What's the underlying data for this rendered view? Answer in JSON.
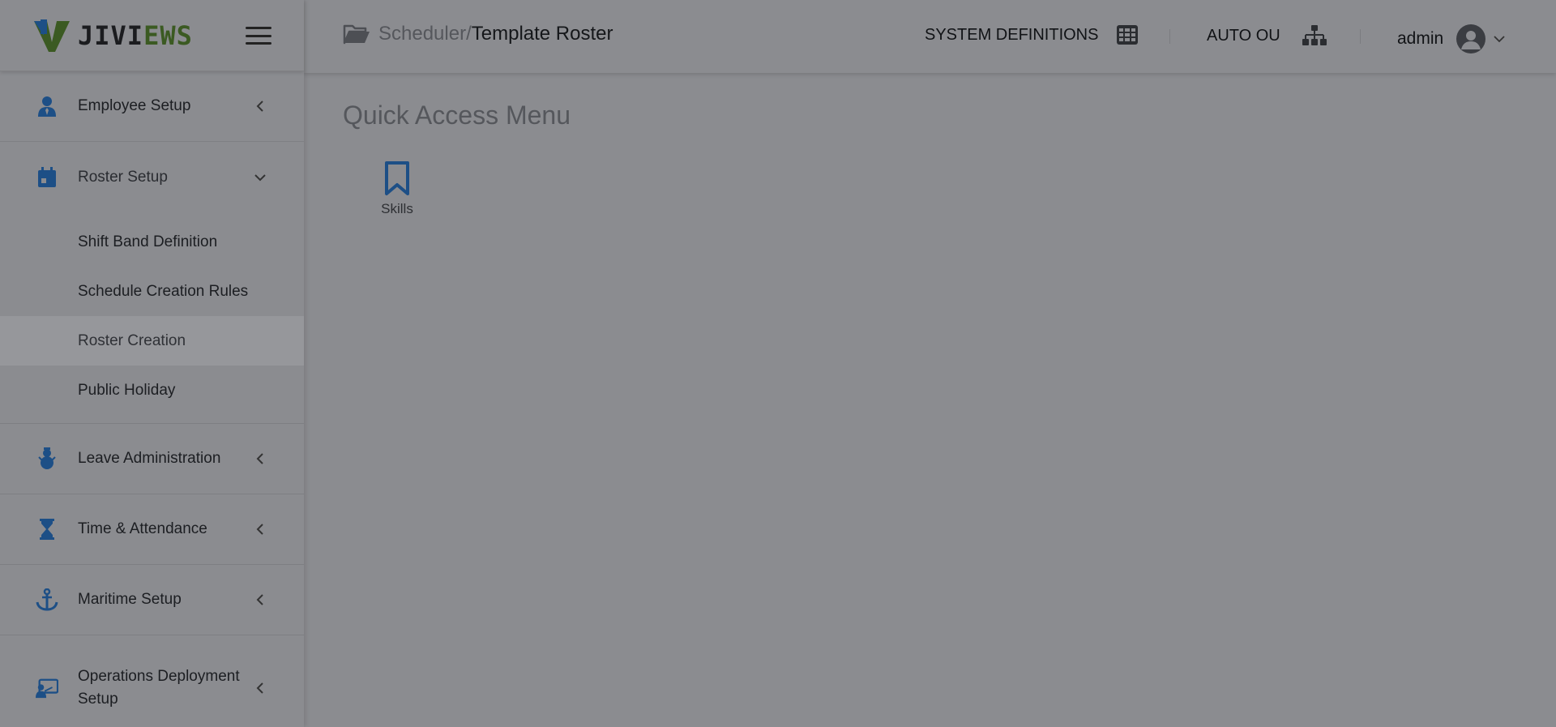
{
  "brand": {
    "logo_prefix": "JIVI",
    "logo_suffix": "EWS",
    "accent_color": "#1d4f86",
    "logo_green": "#3b5a22"
  },
  "header": {
    "breadcrumb_parent": "Scheduler/",
    "breadcrumb_current": "Template Roster",
    "system_definitions_label": "SYSTEM DEFINITIONS",
    "auto_ou_label": "AUTO OU",
    "user_name": "admin"
  },
  "sidebar": {
    "items": [
      {
        "label": "Employee Setup",
        "icon": "user-tie-icon",
        "state": "collapsed"
      },
      {
        "label": "Roster Setup",
        "icon": "calendar-icon",
        "state": "expanded",
        "children": [
          {
            "label": "Shift Band Definition"
          },
          {
            "label": "Schedule Creation Rules"
          },
          {
            "label": "Roster Creation",
            "active": true
          },
          {
            "label": "Public Holiday"
          }
        ]
      },
      {
        "label": "Leave Administration",
        "icon": "snowman-icon",
        "state": "collapsed"
      },
      {
        "label": "Time & Attendance",
        "icon": "hourglass-icon",
        "state": "collapsed"
      },
      {
        "label": "Maritime Setup",
        "icon": "anchor-icon",
        "state": "collapsed"
      },
      {
        "label": "Operations Deployment Setup",
        "icon": "presentation-icon",
        "state": "collapsed"
      }
    ]
  },
  "main": {
    "quick_access_title": "Quick Access Menu",
    "tiles": [
      {
        "label": "Skills",
        "icon": "bookmark-icon"
      }
    ]
  }
}
